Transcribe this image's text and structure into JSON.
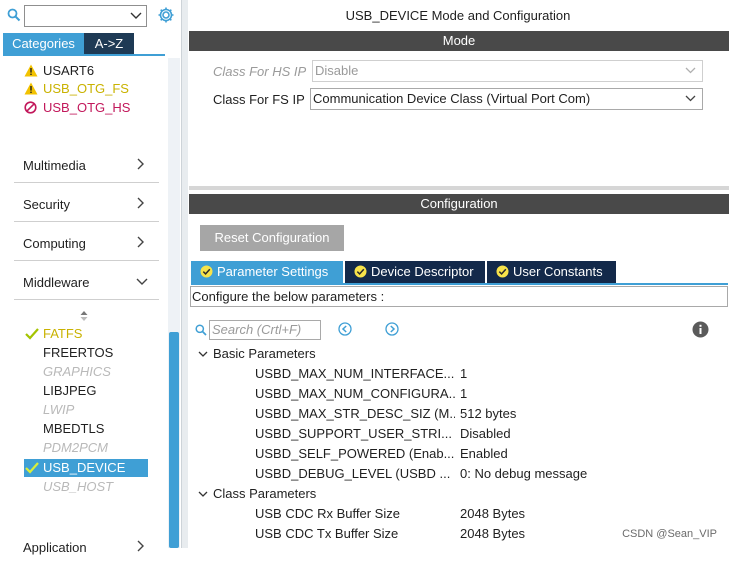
{
  "left_panel": {
    "search": {
      "value": "",
      "placeholder": ""
    },
    "tabs": [
      {
        "label": "Categories",
        "active": true
      },
      {
        "label": "A->Z",
        "active": false
      }
    ],
    "connectivity_items": [
      {
        "label": "USART6",
        "status": "warning",
        "color": "#1f1f1f"
      },
      {
        "label": "USB_OTG_FS",
        "status": "warning",
        "color": "#c9b200"
      },
      {
        "label": "USB_OTG_HS",
        "status": "blocked",
        "color": "#c2185b"
      }
    ],
    "categories": [
      {
        "label": "Multimedia",
        "expanded": false
      },
      {
        "label": "Security",
        "expanded": false
      },
      {
        "label": "Computing",
        "expanded": false
      },
      {
        "label": "Middleware",
        "expanded": true
      }
    ],
    "middleware_items": [
      {
        "label": "FATFS",
        "state": "checked"
      },
      {
        "label": "FREERTOS",
        "state": "normal"
      },
      {
        "label": "GRAPHICS",
        "state": "disabled"
      },
      {
        "label": "LIBJPEG",
        "state": "normal"
      },
      {
        "label": "LWIP",
        "state": "disabled"
      },
      {
        "label": "MBEDTLS",
        "state": "normal"
      },
      {
        "label": "PDM2PCM",
        "state": "disabled"
      },
      {
        "label": "USB_DEVICE",
        "state": "checked-selected"
      },
      {
        "label": "USB_HOST",
        "state": "disabled"
      }
    ],
    "next_category_partial": "Application"
  },
  "main": {
    "title": "USB_DEVICE Mode and Configuration",
    "mode": {
      "header": "Mode",
      "fields": [
        {
          "label": "Class For HS IP",
          "value": "Disable",
          "enabled": false
        },
        {
          "label": "Class For FS IP",
          "value": "Communication Device Class (Virtual Port Com)",
          "enabled": true
        }
      ]
    },
    "configuration": {
      "header": "Configuration",
      "reset_button": "Reset Configuration",
      "tabs": [
        {
          "label": "Parameter Settings",
          "active": true
        },
        {
          "label": "Device Descriptor",
          "active": false
        },
        {
          "label": "User Constants",
          "active": false
        }
      ],
      "caption": "Configure the below parameters :",
      "search_placeholder": "Search (Crtl+F)",
      "groups": [
        {
          "label": "Basic Parameters",
          "params": [
            {
              "name": "USBD_MAX_NUM_INTERFACE...",
              "value": "1"
            },
            {
              "name": "USBD_MAX_NUM_CONFIGURA...",
              "value": "1"
            },
            {
              "name": "USBD_MAX_STR_DESC_SIZ (M...",
              "value": "512 bytes"
            },
            {
              "name": "USBD_SUPPORT_USER_STRI...",
              "value": "Disabled"
            },
            {
              "name": "USBD_SELF_POWERED (Enab...",
              "value": "Enabled"
            },
            {
              "name": "USBD_DEBUG_LEVEL (USBD ...",
              "value": "0: No debug message"
            }
          ]
        },
        {
          "label": "Class Parameters",
          "params": [
            {
              "name": "USB CDC Rx Buffer Size",
              "value": "2048 Bytes"
            },
            {
              "name": "USB CDC Tx Buffer Size",
              "value": "2048 Bytes"
            }
          ]
        }
      ]
    }
  },
  "watermark": "CSDN @Sean_VIP",
  "colors": {
    "accent": "#3f9fd5",
    "dark_tab": "#13294a",
    "section_header": "#494949",
    "warning": "#f2c200",
    "check": "#a4c400",
    "blocked": "#c2185b"
  }
}
